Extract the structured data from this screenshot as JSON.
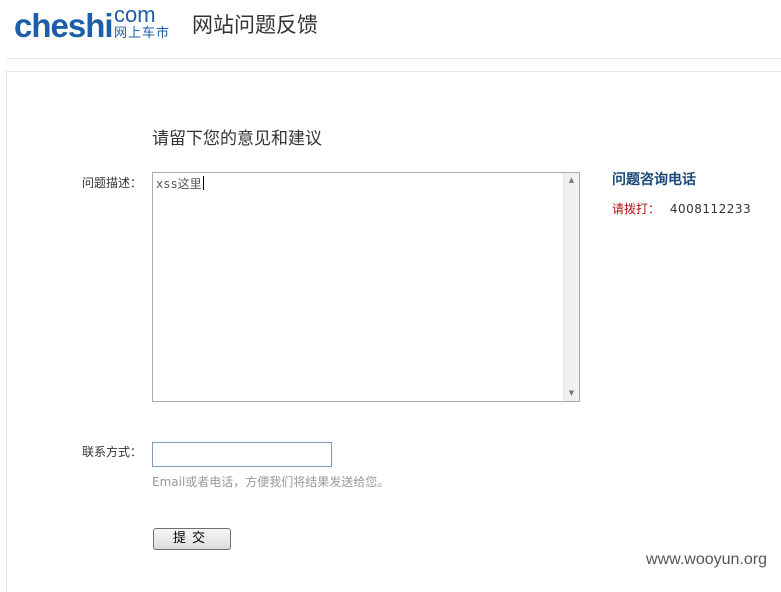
{
  "header": {
    "logo_main": "cheshi",
    "logo_com": "com",
    "logo_cn": "网上车市",
    "title": "网站问题反馈"
  },
  "form": {
    "heading": "请留下您的意见和建议",
    "description_label": "问题描述：",
    "description_value": "xss这里",
    "contact_label": "联系方式：",
    "contact_value": "",
    "contact_hint": "Email或者电话，方便我们将结果发送给您。",
    "submit_label": "提交"
  },
  "sidebar": {
    "title": "问题咨询电话",
    "call_label": "请拨打：",
    "phone": "4008112233"
  },
  "watermark": "www.wooyun.org",
  "colors": {
    "brand": "#1d5ea8",
    "sidebar_title": "#1b4a78",
    "call_label": "#b01010"
  }
}
